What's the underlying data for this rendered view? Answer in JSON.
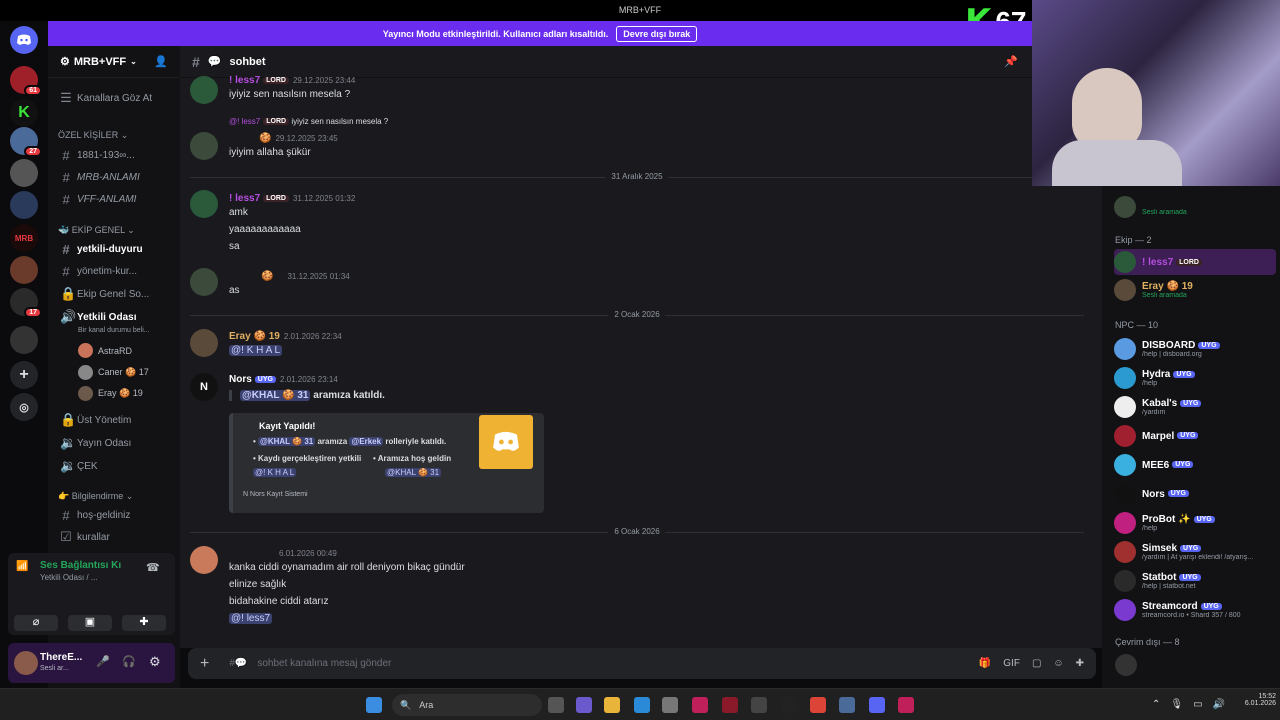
{
  "app": {
    "title": "MRB+VFF"
  },
  "banner": {
    "text": "Yayıncı Modu etkinleştirildi. Kullanıcı adları kısaltıldı.",
    "button": "Devre dışı bırak"
  },
  "overlay": {
    "number": "67",
    "logo_letter": "K",
    "color": "#39e639"
  },
  "rail": {
    "badges": [
      "61",
      "27",
      "17"
    ],
    "server_label": "MRB"
  },
  "sidebar": {
    "guild_name": "MRB+VFF",
    "browse": "Kanallara Göz At",
    "cat_private": "ÖZEL KİŞİLER",
    "channels_private": [
      "1881-193∞...",
      "MRB-ANLAMI",
      "VFF-ANLAMI"
    ],
    "cat_team": "EKİP GENEL",
    "channels_team": [
      "yetkili-duyuru",
      "yönetim-kur...",
      "Ekip Genel So..."
    ],
    "voice_channel": "Yetkili Odası",
    "voice_status": "Bir kanal durumu beli...",
    "voice_users": [
      "AstraRD",
      "Caner 🍪 17",
      "Eray 🍪 19"
    ],
    "channels_more": [
      "Üst Yönetim",
      "Yayın Odası",
      "ÇEK"
    ],
    "cat_info": "Bilgilendirme",
    "channels_info": [
      "hoş-geldiniz",
      "kurallar"
    ]
  },
  "voice_panel": {
    "status": "Ses Bağlantısı Kı",
    "channel": "Yetkili Odası / ..."
  },
  "user_panel": {
    "name": "ThereE...",
    "status": "Sesli ar..."
  },
  "channel": {
    "name": "sohbet",
    "composer_placeholder": "sohbet kanalına mesaj gönder"
  },
  "messages": [
    {
      "author": "! less7",
      "role": "LORD",
      "time": "29.12.2025 23:44",
      "text": "iyiyiz sen nasılsın mesela ?"
    },
    {
      "reply_to_author": "@! less7",
      "reply_role": "LORD",
      "reply_text": "iyiyiz sen nasılsın mesela ?",
      "time": "29.12.2025 23:45",
      "text": "iyiyim allaha şükür"
    },
    {
      "author": "! less7",
      "role": "LORD",
      "time": "31.12.2025 01:32",
      "lines": [
        "amk",
        "yaaaaaaaaaaaa",
        "sa"
      ]
    },
    {
      "time": "31.12.2025 01:34",
      "text": "as"
    },
    {
      "author": "Eray 🍪 19",
      "time": "2.01.2026 22:34",
      "text": "@! K H A L"
    },
    {
      "author": "Nors",
      "tag": "UYG",
      "time": "2.01.2026 23:14",
      "mention": "@KHAL 🍪 31",
      "text": "aramıza katıldı."
    },
    {
      "time": "6.01.2026 00:49",
      "lines": [
        "kanka ciddi oynamadım air roll deniyom bikaç gündür",
        "elinize sağlık",
        "bidahakine ciddi atarız"
      ],
      "mention": "@! less7"
    }
  ],
  "dividers": [
    "31 Aralık 2025",
    "2 Ocak 2026",
    "6 Ocak 2026"
  ],
  "embed": {
    "title": "Kayıt Yapıldı!",
    "line1_mention": "@KHAL 🍪 31",
    "line1_mid": "aramıza",
    "line1_role": "@Erkek",
    "line1_end": "rolleriyle katıldı.",
    "field1_name": "• Kaydı gerçekleştiren yetkili",
    "field1_value": "@! K H A L",
    "field2_name": "• Aramıza hoş geldin",
    "field2_value": "@KHAL 🍪 31",
    "footer": "Nors Kayıt Sistemi"
  },
  "members": {
    "top_status": "Sesli aramada",
    "team_header": "Ekip — 2",
    "team": [
      {
        "name": "! less7",
        "role": "LORD"
      },
      {
        "name": "Eray 🍪 19",
        "sub": "Sesli aramada"
      }
    ],
    "npc_header": "NPC — 10",
    "npc": [
      {
        "name": "DISBOARD",
        "sub": "/help | disboard.org"
      },
      {
        "name": "Hydra",
        "sub": "/help"
      },
      {
        "name": "Kabal's",
        "sub": "/yardım"
      },
      {
        "name": "Marpel",
        "sub": ""
      },
      {
        "name": "MEE6",
        "sub": ""
      },
      {
        "name": "Nors",
        "sub": ""
      },
      {
        "name": "ProBot ✨",
        "sub": "/help"
      },
      {
        "name": "Simsek",
        "sub": "/yardım | At yarışı eklendi! /atyarış..."
      },
      {
        "name": "Statbot",
        "sub": "/help | statbot.net"
      },
      {
        "name": "Streamcord",
        "sub": "streamcord.io • Shard 357 / 800"
      }
    ],
    "bot_tag": "UYG",
    "offline_header": "Çevrim dışı — 8"
  },
  "taskbar": {
    "search": "Ara",
    "time": "15:52",
    "date": "6.01.2026"
  }
}
